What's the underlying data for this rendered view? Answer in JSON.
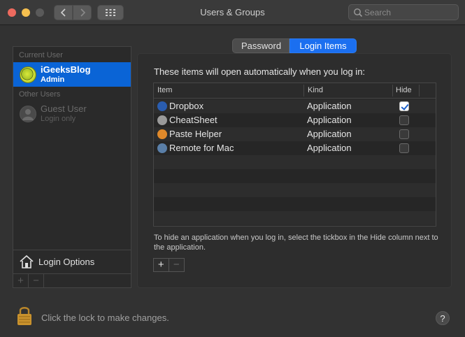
{
  "window": {
    "title": "Users & Groups"
  },
  "search": {
    "placeholder": "Search"
  },
  "users": {
    "current_label": "Current User",
    "current": {
      "name": "iGeeksBlog",
      "role": "Admin"
    },
    "other_label": "Other Users",
    "guest": {
      "name": "Guest User",
      "role": "Login only"
    },
    "login_options": "Login Options",
    "add": "+",
    "remove": "−"
  },
  "tabs": {
    "password": "Password",
    "login_items": "Login Items"
  },
  "main": {
    "intro": "These items will open automatically when you log in:",
    "columns": {
      "item": "Item",
      "kind": "Kind",
      "hide": "Hide"
    },
    "rows": [
      {
        "name": "Dropbox",
        "kind": "Application",
        "hide": true,
        "icon": "dropbox-icon",
        "color": "#2a5db0"
      },
      {
        "name": "CheatSheet",
        "kind": "Application",
        "hide": false,
        "icon": "cheatsheet-icon",
        "color": "#9a9a9a"
      },
      {
        "name": "Paste Helper",
        "kind": "Application",
        "hide": false,
        "icon": "paste-helper-icon",
        "color": "#e0892a"
      },
      {
        "name": "Remote for Mac",
        "kind": "Application",
        "hide": false,
        "icon": "remote-icon",
        "color": "#5a7fa8"
      }
    ],
    "hint": "To hide an application when you log in, select the tickbox in the Hide column next to the application.",
    "add": "+",
    "remove": "−"
  },
  "footer": {
    "lock_text": "Click the lock to make changes.",
    "help": "?"
  },
  "colors": {
    "accent": "#1b6ff0",
    "selection": "#0a64d6"
  }
}
